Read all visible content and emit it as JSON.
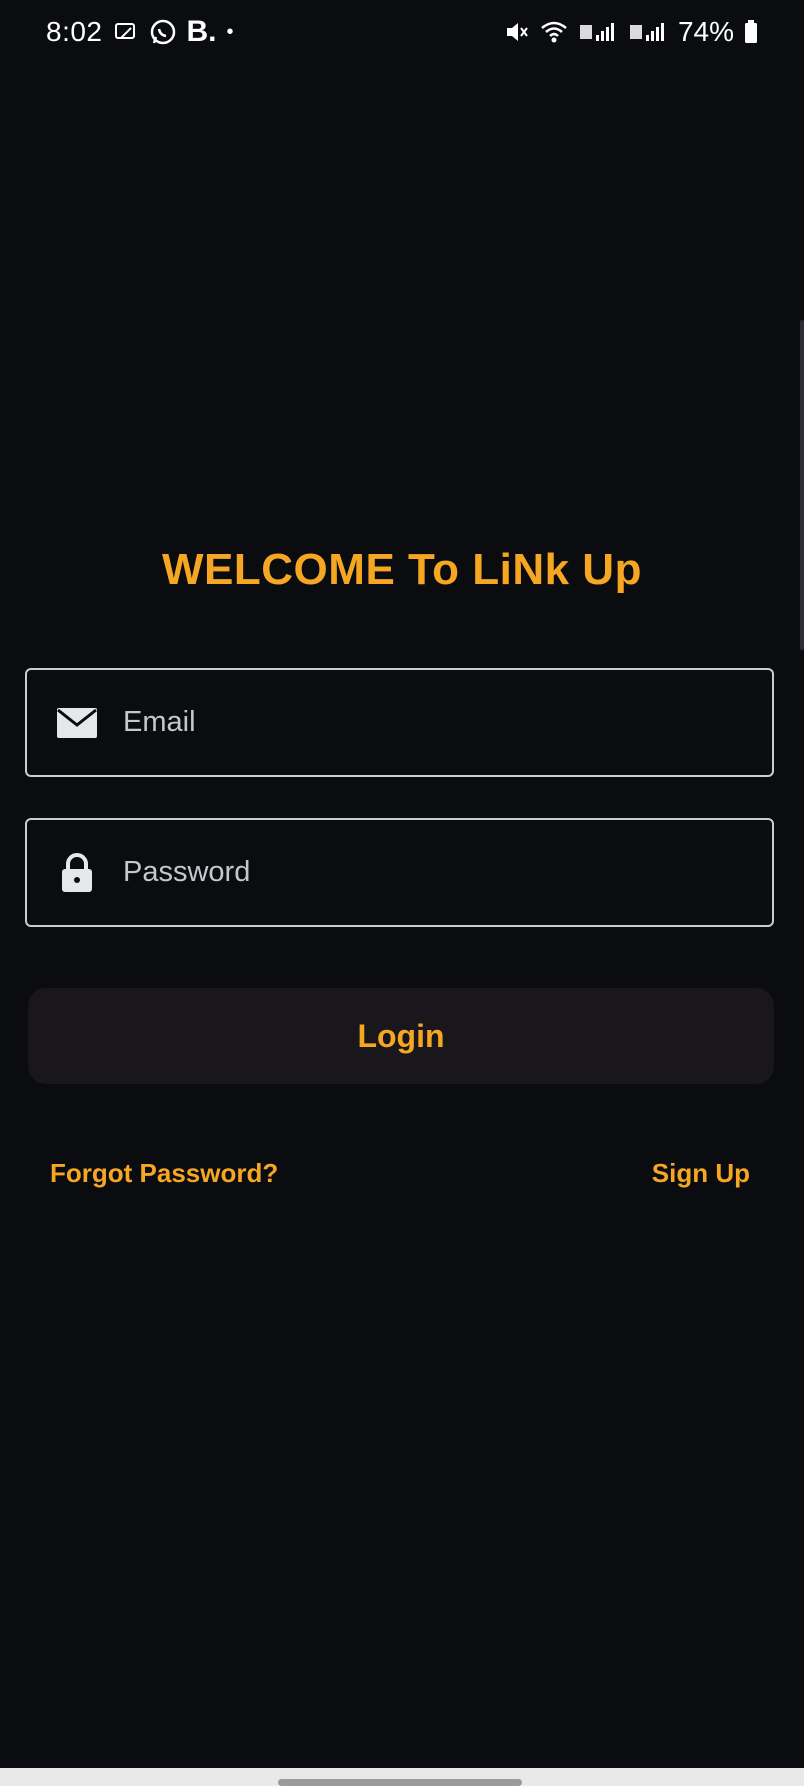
{
  "status_bar": {
    "time": "8:02",
    "carrier_letter": "B.",
    "dot": "•",
    "battery": "74%"
  },
  "login": {
    "title": "WELCOME To LiNk Up",
    "email_placeholder": "Email",
    "password_placeholder": "Password",
    "login_label": "Login",
    "forgot_label": "Forgot Password?",
    "signup_label": "Sign Up"
  },
  "icons": {
    "email": "envelope-icon",
    "password": "lock-icon"
  },
  "colors": {
    "accent": "#f5a623",
    "background": "#0a0c10",
    "button_bg": "#1a171c",
    "field_border": "#c9ccd2"
  }
}
